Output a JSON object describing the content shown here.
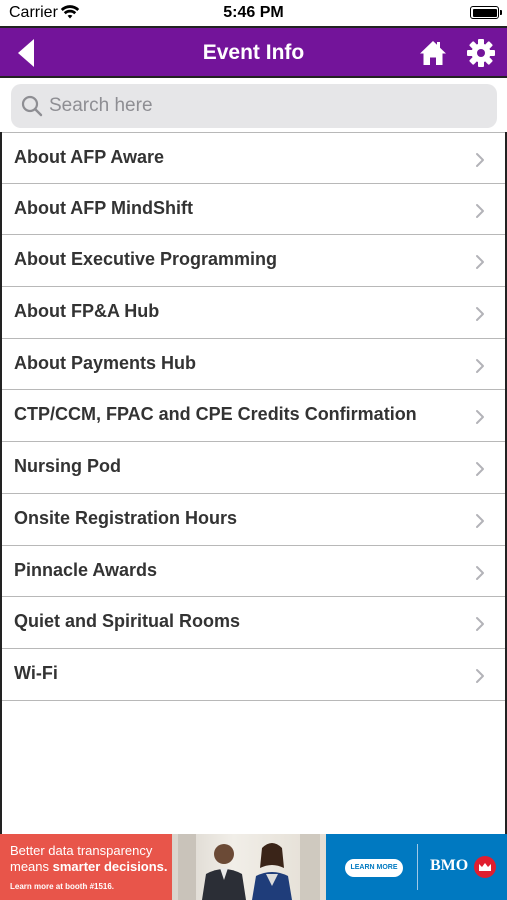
{
  "status_bar": {
    "carrier": "Carrier",
    "time": "5:46 PM"
  },
  "nav": {
    "title": "Event Info",
    "bar_color": "#73149a"
  },
  "search": {
    "placeholder": "Search here",
    "value": ""
  },
  "list": {
    "items": [
      {
        "label": "About AFP Aware"
      },
      {
        "label": "About AFP MindShift"
      },
      {
        "label": "About Executive Programming"
      },
      {
        "label": "About FP&A Hub"
      },
      {
        "label": "About Payments Hub"
      },
      {
        "label": "CTP/CCM, FPAC and CPE Credits Confirmation"
      },
      {
        "label": "Nursing Pod"
      },
      {
        "label": "Onsite Registration Hours"
      },
      {
        "label": "Pinnacle Awards"
      },
      {
        "label": "Quiet and Spiritual Rooms"
      },
      {
        "label": "Wi-Fi"
      }
    ]
  },
  "ad": {
    "line1": "Better data transparency",
    "line2_prefix": "means ",
    "line2_bold": "smarter decisions.",
    "line3": "Learn more at booth #1516.",
    "cta": "LEARN MORE",
    "brand": "BMO",
    "brand_color": "#0079c1",
    "accent_color": "#e8554a"
  }
}
